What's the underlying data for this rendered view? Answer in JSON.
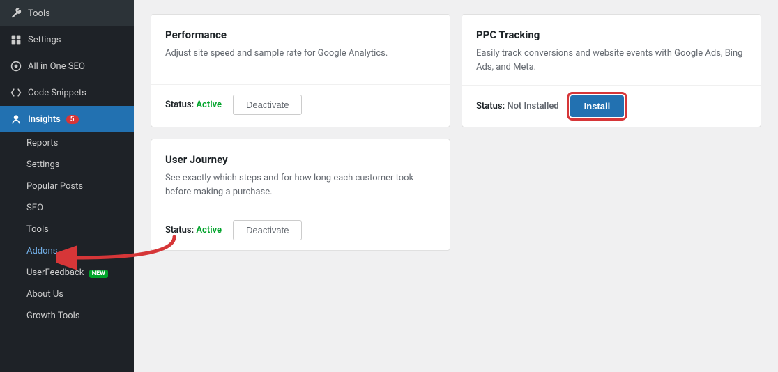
{
  "sidebar": {
    "items": [
      {
        "label": "Tools",
        "icon": "⚙",
        "id": "tools"
      },
      {
        "label": "Settings",
        "icon": "⊞",
        "id": "settings"
      },
      {
        "label": "All in One SEO",
        "icon": "⊙",
        "id": "aio-seo"
      },
      {
        "label": "Code Snippets",
        "icon": "◇",
        "id": "code-snippets"
      },
      {
        "label": "Insights",
        "icon": "👤",
        "id": "insights",
        "badge": "5",
        "active": true
      }
    ],
    "submenu": [
      {
        "label": "Reports",
        "id": "reports"
      },
      {
        "label": "Settings",
        "id": "settings-sub"
      },
      {
        "label": "Popular Posts",
        "id": "popular-posts"
      },
      {
        "label": "SEO",
        "id": "seo"
      },
      {
        "label": "Tools",
        "id": "tools-sub"
      },
      {
        "label": "Addons",
        "id": "addons",
        "active": true
      },
      {
        "label": "UserFeedback",
        "id": "userfeedback",
        "new": true
      },
      {
        "label": "About Us",
        "id": "about-us"
      },
      {
        "label": "Growth Tools",
        "id": "growth-tools"
      }
    ]
  },
  "cards": [
    {
      "id": "performance",
      "title": "Performance",
      "desc": "Adjust site speed and sample rate for Google Analytics.",
      "status_label": "Status:",
      "status_value": "Active",
      "status_type": "active",
      "action_label": "Deactivate"
    },
    {
      "id": "ppc-tracking",
      "title": "PPC Tracking",
      "desc": "Easily track conversions and website events with Google Ads, Bing Ads, and Meta.",
      "status_label": "Status:",
      "status_value": "Not Installed",
      "status_type": "not-installed",
      "action_label": "Install",
      "action_style": "install"
    },
    {
      "id": "user-journey",
      "title": "User Journey",
      "desc": "See exactly which steps and for how long each customer took before making a purchase.",
      "status_label": "Status:",
      "status_value": "Active",
      "status_type": "active",
      "action_label": "Deactivate"
    }
  ],
  "new_badge_label": "NEW",
  "arrow_color": "#d63638"
}
